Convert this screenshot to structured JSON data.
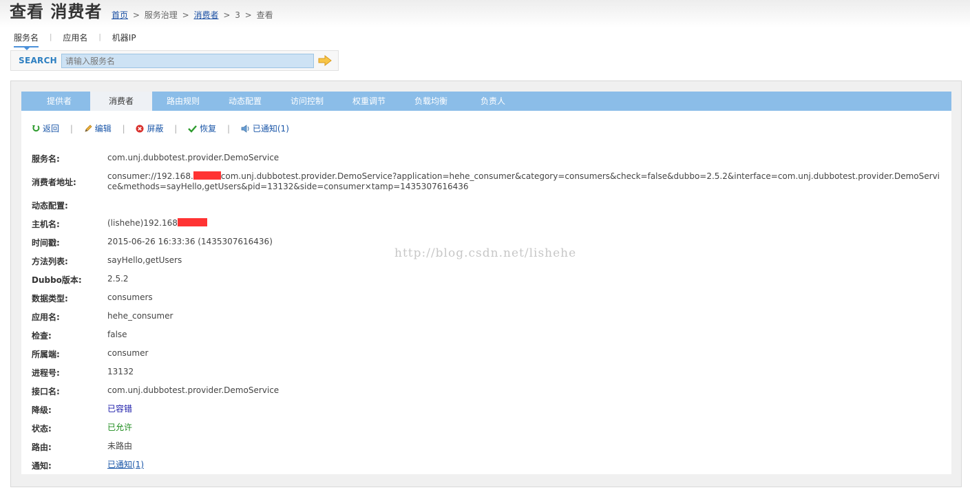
{
  "header": {
    "title": "查看 消费者",
    "breadcrumb": {
      "home": "首页",
      "sep1": ">",
      "service_governance": "服务治理",
      "sep2": ">",
      "consumers": "消费者",
      "sep3": ">",
      "id": "3",
      "sep4": ">",
      "current": "查看"
    }
  },
  "search": {
    "tabs": [
      {
        "label": "服务名",
        "active": true
      },
      {
        "label": "应用名",
        "active": false
      },
      {
        "label": "机器IP",
        "active": false
      }
    ],
    "tab_sep": "|",
    "label": "SEARCH",
    "placeholder": "请输入服务名"
  },
  "tabs": [
    {
      "label": "提供者",
      "active": false
    },
    {
      "label": "消费者",
      "active": true
    },
    {
      "label": "路由规则",
      "active": false
    },
    {
      "label": "动态配置",
      "active": false
    },
    {
      "label": "访问控制",
      "active": false
    },
    {
      "label": "权重调节",
      "active": false
    },
    {
      "label": "负载均衡",
      "active": false
    },
    {
      "label": "负责人",
      "active": false
    }
  ],
  "actions": {
    "back": "返回",
    "edit": "编辑",
    "block": "屏蔽",
    "restore": "恢复",
    "notified": "已通知(1)",
    "sep": "|"
  },
  "details": {
    "service": {
      "label": "服务名:",
      "value": "com.unj.dubbotest.provider.DemoService"
    },
    "address": {
      "label": "消费者地址:",
      "prefix": "consumer://192.168.",
      "suffix": "com.unj.dubbotest.provider.DemoService?application=hehe_consumer&category=consumers&check=false&dubbo=2.5.2&interface=com.unj.dubbotest.provider.DemoService&methods=sayHello,getUsers&pid=13132&side=consumer×tamp=1435307616436"
    },
    "dynamic_config": {
      "label": "动态配置:",
      "value": ""
    },
    "hostname": {
      "label": "主机名:",
      "value": "(lishehe)192.168"
    },
    "timestamp": {
      "label": "时间戳:",
      "value": "2015-06-26 16:33:36 (1435307616436)"
    },
    "methods": {
      "label": "方法列表:",
      "value": "sayHello,getUsers"
    },
    "dubbo_version": {
      "label": "Dubbo版本:",
      "value": "2.5.2"
    },
    "data_type": {
      "label": "数据类型:",
      "value": "consumers"
    },
    "application": {
      "label": "应用名:",
      "value": "hehe_consumer"
    },
    "check": {
      "label": "检查:",
      "value": "false"
    },
    "side": {
      "label": "所属端:",
      "value": "consumer"
    },
    "pid": {
      "label": "进程号:",
      "value": "13132"
    },
    "interface": {
      "label": "接口名:",
      "value": "com.unj.dubbotest.provider.DemoService"
    },
    "degrade": {
      "label": "降级:",
      "value": "已容错"
    },
    "status": {
      "label": "状态:",
      "value": "已允许"
    },
    "route": {
      "label": "路由:",
      "value": "未路由"
    },
    "notify": {
      "label": "通知:",
      "value": "已通知(1)"
    }
  },
  "watermark": "http://blog.csdn.net/lishehe",
  "colors": {
    "tab_bar": "#8bbde8",
    "search_label": "#2d7fc1",
    "link": "#1a56a8",
    "redaction": "#ff3333",
    "degrade": "#1a1aa8",
    "status_ok": "#1a8a1a"
  }
}
